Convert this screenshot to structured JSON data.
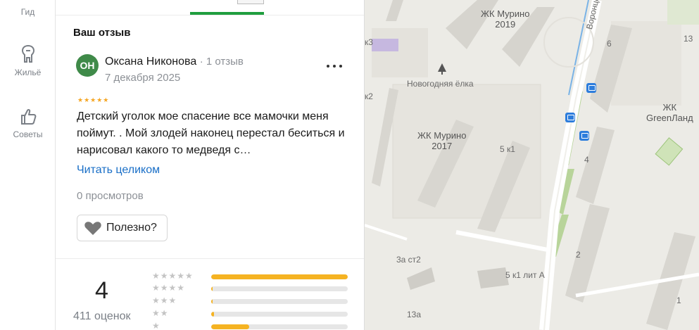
{
  "nav": {
    "items": [
      {
        "label": "Гид",
        "icon": "guide-icon"
      },
      {
        "label": "Жильё",
        "icon": "housing-icon"
      },
      {
        "label": "Советы",
        "icon": "thumbs-up-icon"
      }
    ]
  },
  "review": {
    "section_title": "Ваш отзыв",
    "avatar_initials": "ОН",
    "avatar_color": "#3f8a49",
    "author_name": "Оксана Никонова",
    "author_meta": "· 1 отзыв",
    "date": "7 декабря 2025",
    "rating": 5,
    "stars_text": "★★★★★",
    "text": "Детский уголок мое спасение все мамочки меня поймут. . Мой злодей наконец перестал беситься и нарисовал какого то медведя с…",
    "read_more": "Читать целиком",
    "views": "0 просмотров",
    "helpful_label": "Полезно?"
  },
  "summary": {
    "average": "4",
    "count": "411 оценок",
    "distribution": [
      {
        "stars": "★★★★★",
        "fraction": 1.0
      },
      {
        "stars": "★★★★",
        "fraction": 0.01
      },
      {
        "stars": "★★★",
        "fraction": 0.01
      },
      {
        "stars": "★★",
        "fraction": 0.02
      },
      {
        "stars": "★",
        "fraction": 0.28
      }
    ]
  },
  "map": {
    "labels": [
      {
        "text": "ЖК Мурино\n2019",
        "kind": "complex"
      },
      {
        "text": "Новогодняя ёлка",
        "kind": "poi"
      },
      {
        "text": "ЖК Мурино\n2017",
        "kind": "complex"
      },
      {
        "text": "ЖК\nGreenЛанд",
        "kind": "complex"
      },
      {
        "text": "Воронцовский",
        "kind": "street"
      },
      {
        "text": "5 к1",
        "kind": "house"
      },
      {
        "text": "5 к1 лит А",
        "kind": "house"
      },
      {
        "text": "3а ст2",
        "kind": "house"
      },
      {
        "text": "13а",
        "kind": "house"
      },
      {
        "text": "6",
        "kind": "house"
      },
      {
        "text": "4",
        "kind": "house"
      },
      {
        "text": "2",
        "kind": "house"
      },
      {
        "text": "1",
        "kind": "house"
      },
      {
        "text": "13",
        "kind": "house"
      },
      {
        "text": "к3",
        "kind": "house"
      },
      {
        "text": "к2",
        "kind": "house"
      }
    ]
  },
  "colors": {
    "accent": "#1f9e3e",
    "link": "#1a6fc7",
    "star": "#f5a623",
    "bar": "#f5b322"
  }
}
